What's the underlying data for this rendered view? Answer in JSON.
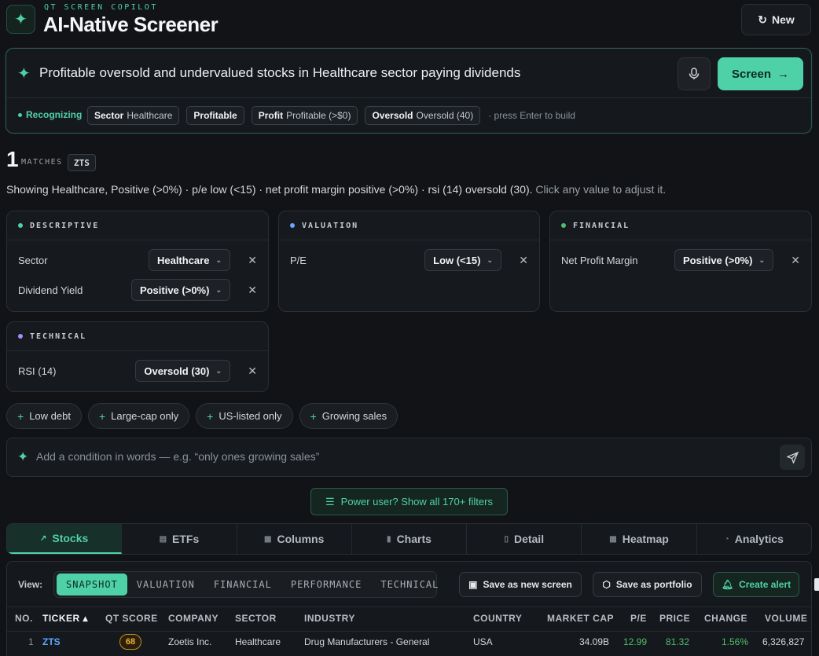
{
  "header": {
    "eyebrow": "QT SCREEN COPILOT",
    "title": "AI-Native Screener",
    "new_label": "New"
  },
  "query": {
    "text": "Profitable oversold and undervalued stocks in Healthcare sector paying dividends",
    "screen_label": "Screen",
    "recognizing_label": "Recognizing",
    "chips": [
      {
        "key": "Sector",
        "value": "Healthcare"
      },
      {
        "key": "Profitable",
        "value": ""
      },
      {
        "key": "Profit",
        "value": "Profitable (>$0)"
      },
      {
        "key": "Oversold",
        "value": "Oversold (40)"
      }
    ],
    "hint": "· press Enter to build"
  },
  "matches": {
    "count": "1",
    "label": "MATCHES",
    "tickers": [
      "ZTS"
    ],
    "summary": "Showing Healthcare, Positive (>0%) · p/e low (<15) · net profit margin positive (>0%) · rsi (14) oversold (30).",
    "summary_hint": " Click any value to adjust it."
  },
  "cards": {
    "descriptive": {
      "title": "DESCRIPTIVE",
      "color": "#4fd1a8",
      "rows": [
        {
          "label": "Sector",
          "value": "Healthcare"
        },
        {
          "label": "Dividend Yield",
          "value": "Positive (>0%)"
        }
      ]
    },
    "valuation": {
      "title": "VALUATION",
      "color": "#6aa6ff",
      "rows": [
        {
          "label": "P/E",
          "value": "Low (<15)"
        }
      ]
    },
    "financial": {
      "title": "FINANCIAL",
      "color": "#4fbf6a",
      "rows": [
        {
          "label": "Net Profit Margin",
          "value": "Positive (>0%)"
        }
      ]
    },
    "technical": {
      "title": "TECHNICAL",
      "color": "#a98bff",
      "rows": [
        {
          "label": "RSI (14)",
          "value": "Oversold (30)"
        }
      ]
    }
  },
  "suggestions": [
    "Low debt",
    "Large-cap only",
    "US-listed only",
    "Growing sales"
  ],
  "condition": {
    "placeholder": "Add a condition in words — e.g. “only ones growing sales”"
  },
  "power_user_label": "Power user? Show all 170+ filters",
  "tabs": [
    "Stocks",
    "ETFs",
    "Columns",
    "Charts",
    "Detail",
    "Heatmap",
    "Analytics"
  ],
  "view": {
    "label": "View:",
    "segments": [
      "SNAPSHOT",
      "VALUATION",
      "FINANCIAL",
      "PERFORMANCE",
      "TECHNICAL"
    ],
    "save_screen": "Save as new screen",
    "save_portfolio": "Save as portfolio",
    "create_alert": "Create alert"
  },
  "table": {
    "headers": [
      "NO.",
      "TICKER ▴",
      "QT SCORE",
      "COMPANY",
      "SECTOR",
      "INDUSTRY",
      "COUNTRY",
      "MARKET CAP",
      "P/E",
      "PRICE",
      "CHANGE",
      "VOLUME"
    ],
    "rows": [
      [
        "1",
        "ZTS",
        "68",
        "Zoetis Inc.",
        "Healthcare",
        "Drug Manufacturers - General",
        "USA",
        "34.09B",
        "12.99",
        "81.32",
        "1.56%",
        "6,326,827"
      ]
    ]
  }
}
